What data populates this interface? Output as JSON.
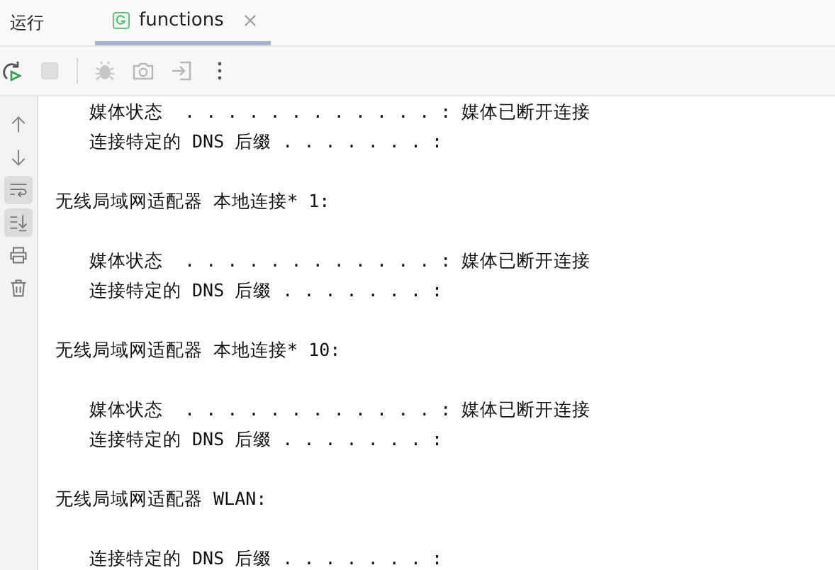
{
  "tool_window": {
    "title": "运行"
  },
  "tabs": [
    {
      "label": "functions",
      "selected": true
    }
  ],
  "toolbar": [
    {
      "kind": "rerun",
      "disabled": false
    },
    {
      "kind": "stop",
      "disabled": true
    },
    {
      "kind": "separator"
    },
    {
      "kind": "debug",
      "disabled": true
    },
    {
      "kind": "camera",
      "disabled": true
    },
    {
      "kind": "exit",
      "disabled": true
    },
    {
      "kind": "more",
      "disabled": false
    }
  ],
  "side_actions": [
    {
      "kind": "up",
      "selected": false
    },
    {
      "kind": "down",
      "selected": false
    },
    {
      "kind": "wrap",
      "selected": true
    },
    {
      "kind": "scroll_end",
      "selected": true
    },
    {
      "kind": "print",
      "selected": false
    },
    {
      "kind": "trash",
      "selected": false
    }
  ],
  "console": {
    "sections": [
      {
        "lines": [
          {
            "kind": "entry",
            "text": "媒体状态  . . . . . . . . . . . . : 媒体已断开连接"
          },
          {
            "kind": "entry",
            "text": "连接特定的 DNS 后缀 . . . . . . . :"
          }
        ]
      },
      {
        "lines": [
          {
            "kind": "heading",
            "text": "无线局域网适配器 本地连接* 1:"
          }
        ]
      },
      {
        "lines": [
          {
            "kind": "entry",
            "text": "媒体状态  . . . . . . . . . . . . : 媒体已断开连接"
          },
          {
            "kind": "entry",
            "text": "连接特定的 DNS 后缀 . . . . . . . :"
          }
        ]
      },
      {
        "lines": [
          {
            "kind": "heading",
            "text": "无线局域网适配器 本地连接* 10:"
          }
        ]
      },
      {
        "lines": [
          {
            "kind": "entry",
            "text": "媒体状态  . . . . . . . . . . . . : 媒体已断开连接"
          },
          {
            "kind": "entry",
            "text": "连接特定的 DNS 后缀 . . . . . . . :"
          }
        ]
      },
      {
        "lines": [
          {
            "kind": "heading",
            "text": "无线局域网适配器 WLAN:"
          }
        ]
      },
      {
        "lines": [
          {
            "kind": "entry",
            "text": "连接特定的 DNS 后缀 . . . . . . . :"
          }
        ]
      }
    ]
  }
}
